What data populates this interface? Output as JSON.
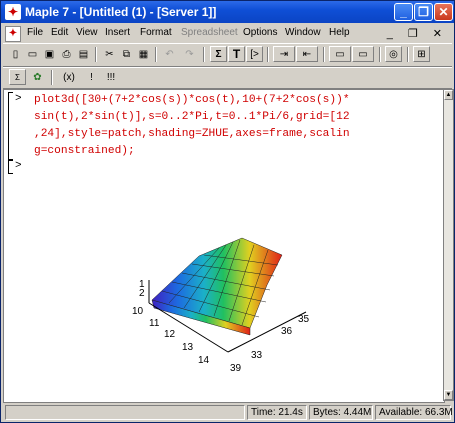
{
  "window": {
    "title": "Maple 7 - [Untitled (1) - [Server 1]]",
    "app_icon": "maple-leaf-icon",
    "controls": [
      "_",
      "❐",
      "✕"
    ]
  },
  "menu": {
    "items": [
      "File",
      "Edit",
      "View",
      "Insert",
      "Format",
      "Spreadsheet",
      "Options",
      "Window",
      "Help"
    ],
    "disabled": [
      "Spreadsheet"
    ],
    "mdi_controls": [
      "_",
      "❐",
      "✕"
    ]
  },
  "toolbar": {
    "buttons": [
      "new-icon",
      "open-icon",
      "save-icon",
      "print-icon",
      "cut-icon",
      "copy-icon",
      "paste-icon",
      "undo-icon",
      "redo-icon",
      "sigma-icon",
      "text-icon",
      "bracket-icon",
      "indent-icon",
      "outdent-icon",
      "collapse-icon",
      "expand-icon",
      "stop-icon",
      "restart-icon"
    ],
    "sigma": "Σ",
    "text": "T"
  },
  "context_toolbar": {
    "buttons": [
      "math-icon",
      "maple-leaf-icon",
      "eval-icon",
      "exec-icon",
      "execall-icon"
    ],
    "labels": [
      "(x)",
      "!",
      "!!!"
    ]
  },
  "worksheet": {
    "prompt": ">",
    "command_lines": [
      "plot3d([30+(7+2*cos(s))*cos(t),10+(7+2*cos(s))*",
      "sin(t),2*sin(t)],s=0..2*Pi,t=0..1*Pi/6,grid=[12",
      ",24],style=patch,shading=ZHUE,axes=frame,scalin",
      "g=constrained);"
    ],
    "prompt2": ">",
    "plot": {
      "z_ticks": [
        "1",
        "2"
      ],
      "x_ticks": [
        "10",
        "11",
        "12",
        "13",
        "14"
      ],
      "y_ticks": [
        "33",
        "36",
        "35",
        "39"
      ]
    }
  },
  "status": {
    "time": "Time: 21.4s",
    "bytes": "Bytes: 4.44M",
    "available": "Available: 66.3M"
  }
}
